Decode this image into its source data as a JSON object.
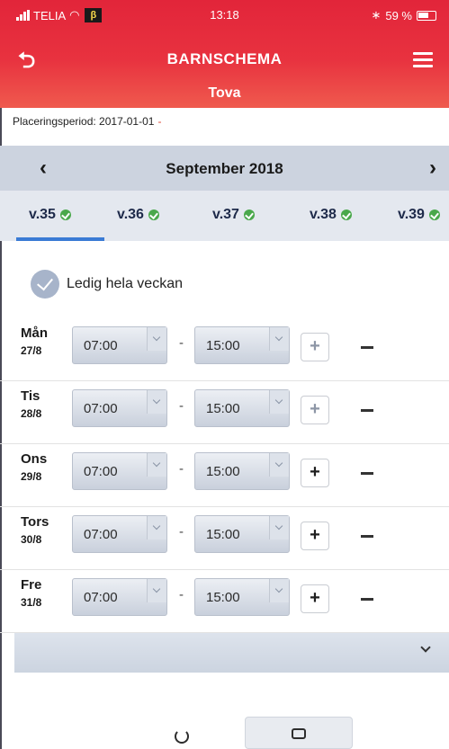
{
  "status_bar": {
    "carrier": "TELIA",
    "beta": "β",
    "time": "13:18",
    "battery_text": "59 %",
    "bluetooth": "∗"
  },
  "header": {
    "back_icon": "back-arrow-icon",
    "title": "BARNSCHEMA",
    "menu_icon": "hamburger-menu-icon",
    "child_name": "Tova",
    "color": "#e8323f"
  },
  "placement_period": {
    "label": "Placeringsperiod: 2017-01-01",
    "dot": "-"
  },
  "month_nav": {
    "prev": "‹",
    "label": "September 2018",
    "next": "›"
  },
  "weeks": [
    {
      "label": "v.35",
      "selected": true
    },
    {
      "label": "v.36",
      "selected": false
    },
    {
      "label": "v.37",
      "selected": false
    },
    {
      "label": "v.38",
      "selected": false
    },
    {
      "label": "v.39",
      "selected": false
    }
  ],
  "free_week": {
    "label": "Ledig hela veckan"
  },
  "days": [
    {
      "name": "Mån",
      "date": "27/8",
      "from": "07:00",
      "to": "15:00",
      "dash": "-"
    },
    {
      "name": "Tis",
      "date": "28/8",
      "from": "07:00",
      "to": "15:00",
      "dash": "-"
    },
    {
      "name": "Ons",
      "date": "29/8",
      "from": "07:00",
      "to": "15:00",
      "dash": "-"
    },
    {
      "name": "Tors",
      "date": "30/8",
      "from": "07:00",
      "to": "15:00",
      "dash": "-"
    },
    {
      "name": "Fre",
      "date": "31/8",
      "from": "07:00",
      "to": "15:00",
      "dash": "-"
    }
  ],
  "buttons": {
    "plus": "+",
    "refresh_icon": "refresh-icon",
    "save_icon": "save-icon"
  },
  "accent_colors": {
    "header_red": "#e8323f",
    "week_check_green": "#4aa84b",
    "selected_underline": "#3a7bd5"
  }
}
